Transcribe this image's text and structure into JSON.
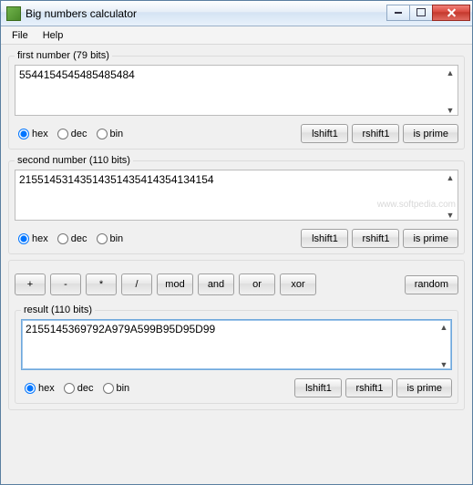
{
  "window": {
    "title": "Big numbers calculator"
  },
  "menu": {
    "file": "File",
    "help": "Help"
  },
  "firstNumber": {
    "legend": "first number (79 bits)",
    "value": "5544154545485485484"
  },
  "secondNumber": {
    "legend": "second number (110 bits)",
    "value": "21551453143514351435414354134154"
  },
  "result": {
    "legend": "result (110 bits)",
    "value": "2155145369792A979A599B95D95D99"
  },
  "radix": {
    "hex": "hex",
    "dec": "dec",
    "bin": "bin"
  },
  "buttons": {
    "lshift": "lshift1",
    "rshift": "rshift1",
    "isprime": "is prime",
    "random": "random"
  },
  "ops": {
    "add": "+",
    "sub": "-",
    "mul": "*",
    "div": "/",
    "mod": "mod",
    "and": "and",
    "or": "or",
    "xor": "xor"
  },
  "watermark": "www.softpedia.com"
}
